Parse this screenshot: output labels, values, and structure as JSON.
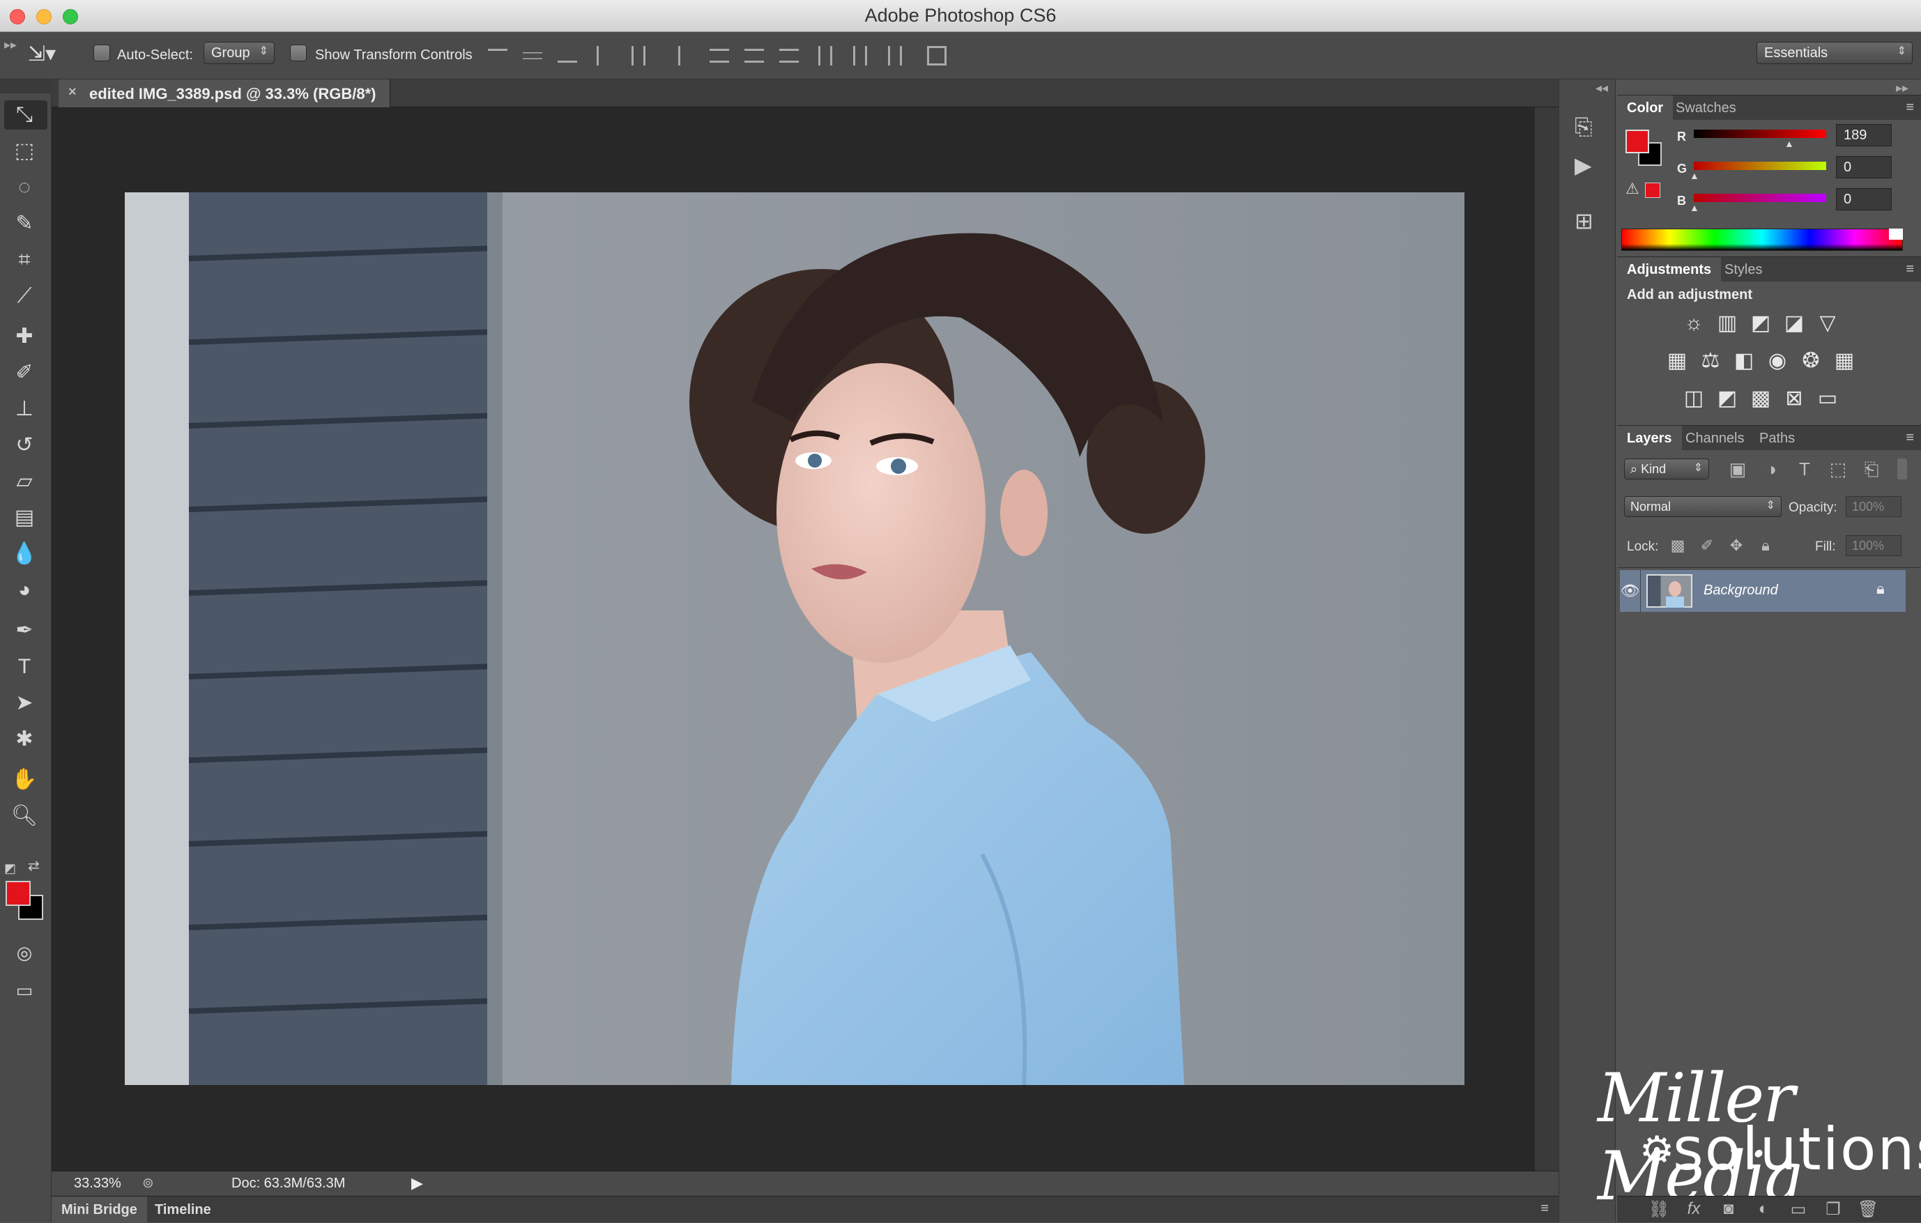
{
  "app": {
    "title": "Adobe Photoshop CS6"
  },
  "options": {
    "auto_select_label": "Auto-Select:",
    "auto_select_value": "Group",
    "show_transform_label": "Show Transform Controls",
    "workspace": "Essentials"
  },
  "document": {
    "tab_title": "edited IMG_3389.psd @ 33.3% (RGB/8*)",
    "zoom": "33.33%",
    "doc_size": "Doc: 63.3M/63.3M"
  },
  "bottom_tabs": [
    "Mini Bridge",
    "Timeline"
  ],
  "color_panel": {
    "tabs": [
      "Color",
      "Swatches"
    ],
    "r_label": "R",
    "g_label": "G",
    "b_label": "B",
    "r": "189",
    "g": "0",
    "b": "0",
    "foreground": "#e3131b",
    "background": "#000000"
  },
  "adjustments_panel": {
    "tabs": [
      "Adjustments",
      "Styles"
    ],
    "heading": "Add an adjustment"
  },
  "layers_panel": {
    "tabs": [
      "Layers",
      "Channels",
      "Paths"
    ],
    "filter_kind": "Kind",
    "blend_mode": "Normal",
    "opacity_label": "Opacity:",
    "opacity_value": "100%",
    "lock_label": "Lock:",
    "fill_label": "Fill:",
    "fill_value": "100%",
    "layers": [
      {
        "name": "Background",
        "visible": true,
        "locked": true
      }
    ]
  },
  "watermark": {
    "line1": "Miller Media",
    "line2": "solutions"
  }
}
